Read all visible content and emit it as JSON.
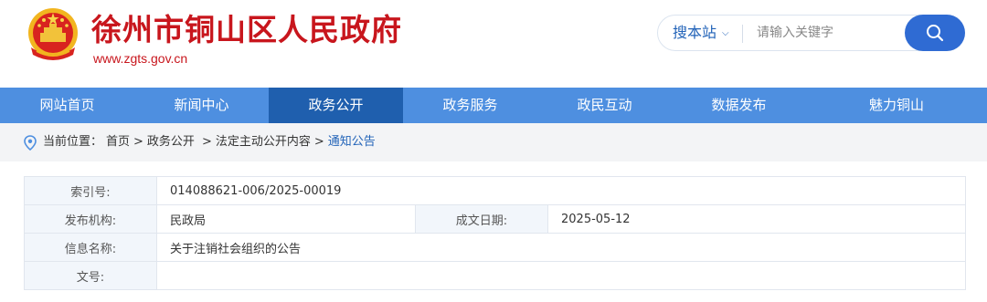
{
  "header": {
    "site_title": "徐州市铜山区人民政府",
    "domain": "www.zgts.gov.cn",
    "emblem_icon": "national-emblem-icon",
    "brand_color": "#c8161d"
  },
  "search": {
    "scope_label": "搜本站",
    "scope_icon": "chevron-down-icon",
    "placeholder": "请输入关键字",
    "button_icon": "search-icon",
    "accent_color": "#2f6bd3"
  },
  "nav": {
    "items": [
      {
        "label": "网站首页"
      },
      {
        "label": "新闻中心"
      },
      {
        "label": "政务公开"
      },
      {
        "label": "政务服务"
      },
      {
        "label": "政民互动"
      },
      {
        "label": "数据发布"
      },
      {
        "label": "魅力铜山"
      }
    ],
    "active_index": 2,
    "bar_color": "#4e8fe0",
    "active_color": "#1f5fae"
  },
  "breadcrumb": {
    "icon": "location-pin-icon",
    "prefix": "当前位置：",
    "items": [
      "首页",
      "政务公开",
      "法定主动公开内容",
      "通知公告"
    ],
    "separator": ">"
  },
  "meta": {
    "index_label": "索引号:",
    "index_value": "014088621-006/2025-00019",
    "org_label": "发布机构:",
    "org_value": "民政局",
    "date_label": "成文日期:",
    "date_value": "2025-05-12",
    "title_label": "信息名称:",
    "title_value": "关于注销社会组织的公告",
    "docno_label": "文号:",
    "docno_value": ""
  }
}
